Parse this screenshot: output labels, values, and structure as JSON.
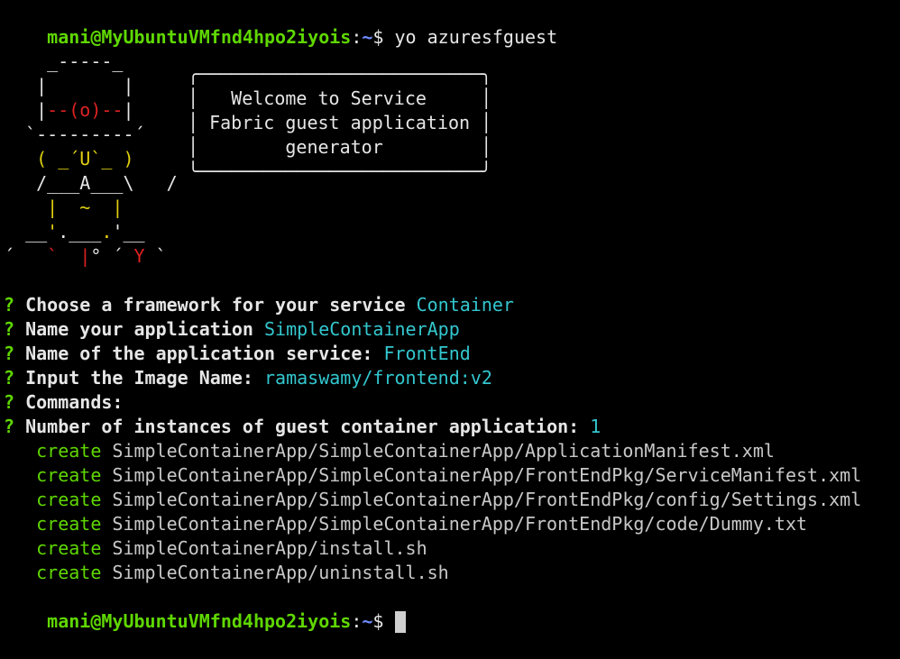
{
  "prompt": {
    "user_host": "mani@MyUbuntuVMfnd4hpo2iyois",
    "separator": ":",
    "path": "~",
    "symbol": "$",
    "command": "yo azuresfguest"
  },
  "banner": {
    "art": [
      "    _-----_     ",
      "   |       |    ",
      "   |--(o)--|    ",
      "  `---------´   ",
      "   ( _´U`_ )    ",
      "   /___A___\\   /",
      "    |  ~  |     ",
      "  __'.___.'__   ",
      "´   `  |° ´ Y ` "
    ],
    "box_lines": [
      "╭──────────────────────────╮",
      "│   Welcome to Service     │",
      "│ Fabric guest application │",
      "│        generator         │",
      "╰──────────────────────────╯"
    ],
    "colors": {
      "frame": "#e6e6e6",
      "eyes": "#dd2222",
      "body": "#e1d00f"
    }
  },
  "questions": [
    {
      "marker": "?",
      "label": "Choose a framework for your service ",
      "answer": "Container"
    },
    {
      "marker": "?",
      "label": "Name your application ",
      "answer": "SimpleContainerApp"
    },
    {
      "marker": "?",
      "label": "Name of the application service: ",
      "answer": "FrontEnd"
    },
    {
      "marker": "?",
      "label": "Input the Image Name: ",
      "answer": "ramaswamy/frontend:v2"
    },
    {
      "marker": "?",
      "label": "Commands: ",
      "answer": ""
    },
    {
      "marker": "?",
      "label": "Number of instances of guest container application: ",
      "answer": "1"
    }
  ],
  "created_files": [
    {
      "action": "create",
      "path": "SimpleContainerApp/SimpleContainerApp/ApplicationManifest.xml"
    },
    {
      "action": "create",
      "path": "SimpleContainerApp/SimpleContainerApp/FrontEndPkg/ServiceManifest.xml"
    },
    {
      "action": "create",
      "path": "SimpleContainerApp/SimpleContainerApp/FrontEndPkg/config/Settings.xml"
    },
    {
      "action": "create",
      "path": "SimpleContainerApp/SimpleContainerApp/FrontEndPkg/code/Dummy.txt"
    },
    {
      "action": "create",
      "path": "SimpleContainerApp/install.sh"
    },
    {
      "action": "create",
      "path": "SimpleContainerApp/uninstall.sh"
    }
  ],
  "final_prompt": {
    "user_host": "mani@MyUbuntuVMfnd4hpo2iyois",
    "separator": ":",
    "path": "~",
    "symbol": "$"
  },
  "theme": {
    "background": "#000000",
    "prompt_user": "#5fd700",
    "prompt_path": "#6f8bff",
    "answer": "#33c7cf",
    "question_marker": "#5fd700",
    "create_action": "#5fd700"
  }
}
